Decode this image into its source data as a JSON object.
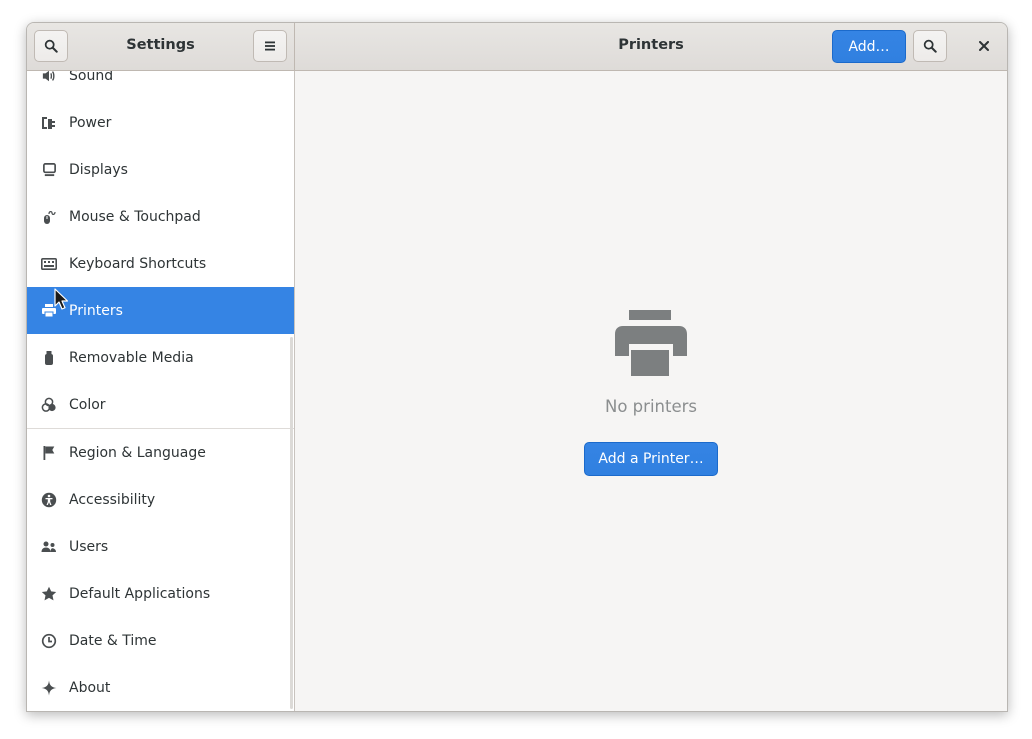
{
  "window": {
    "sidebar_title": "Settings",
    "main_title": "Printers",
    "add_button": "Add…"
  },
  "sidebar": {
    "items": [
      {
        "label": "Sound",
        "icon": "speaker-icon"
      },
      {
        "label": "Power",
        "icon": "power-plug-icon"
      },
      {
        "label": "Displays",
        "icon": "display-icon"
      },
      {
        "label": "Mouse & Touchpad",
        "icon": "mouse-icon"
      },
      {
        "label": "Keyboard Shortcuts",
        "icon": "keyboard-icon"
      },
      {
        "label": "Printers",
        "icon": "printer-icon",
        "selected": true
      },
      {
        "label": "Removable Media",
        "icon": "usb-drive-icon"
      },
      {
        "label": "Color",
        "icon": "color-icon"
      },
      {
        "label": "Region & Language",
        "icon": "flag-icon"
      },
      {
        "label": "Accessibility",
        "icon": "accessibility-icon"
      },
      {
        "label": "Users",
        "icon": "users-icon"
      },
      {
        "label": "Default Applications",
        "icon": "star-icon"
      },
      {
        "label": "Date & Time",
        "icon": "clock-icon"
      },
      {
        "label": "About",
        "icon": "sparkle-icon"
      }
    ]
  },
  "main": {
    "empty_state": {
      "icon": "printer-icon",
      "message": "No printers",
      "button": "Add a Printer…"
    }
  },
  "colors": {
    "accent": "#3584e4",
    "text": "#2e3436",
    "muted": "#8b8e8f",
    "icon_gray": "#7c7f80"
  }
}
